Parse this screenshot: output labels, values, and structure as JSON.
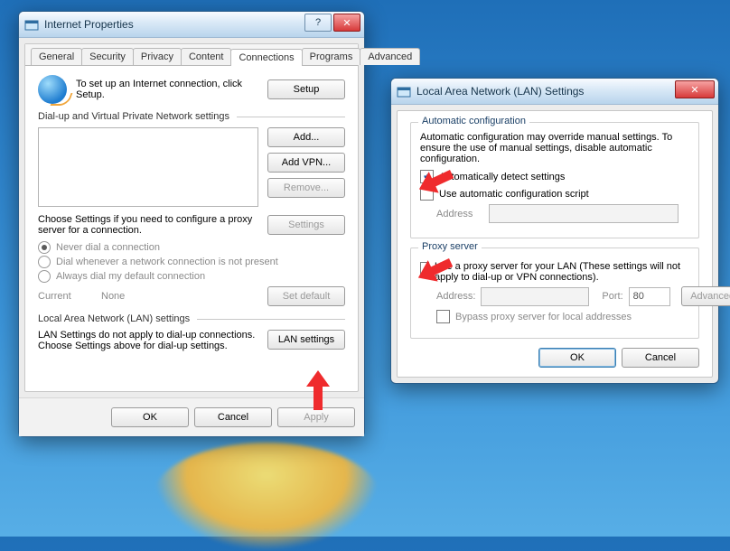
{
  "dialog1": {
    "title": "Internet Properties",
    "tabs": [
      "General",
      "Security",
      "Privacy",
      "Content",
      "Connections",
      "Programs",
      "Advanced"
    ],
    "activeTab": "Connections",
    "intro": "To set up an Internet connection, click Setup.",
    "setupBtn": "Setup",
    "group_dialup": "Dial-up and Virtual Private Network settings",
    "addBtn": "Add...",
    "addVpnBtn": "Add VPN...",
    "removeBtn": "Remove...",
    "chooseSettings": "Choose Settings if you need to configure a proxy server for a connection.",
    "settingsBtn": "Settings",
    "radios": {
      "never": "Never dial a connection",
      "whenever": "Dial whenever a network connection is not present",
      "always": "Always dial my default connection"
    },
    "currentLbl": "Current",
    "currentVal": "None",
    "setDefaultBtn": "Set default",
    "group_lan": "Local Area Network (LAN) settings",
    "lanNote1": "LAN Settings do not apply to dial-up connections.",
    "lanNote2": "Choose Settings above for dial-up settings.",
    "lanBtn": "LAN settings",
    "ok": "OK",
    "cancel": "Cancel",
    "apply": "Apply"
  },
  "dialog2": {
    "title": "Local Area Network (LAN) Settings",
    "group_auto": "Automatic configuration",
    "autoNote": "Automatic configuration may override manual settings. To ensure the use of manual settings, disable automatic configuration.",
    "chk_autoDetect": "Automatically detect settings",
    "chk_autoScript": "Use automatic configuration script",
    "addressLbl": "Address",
    "group_proxy": "Proxy server",
    "chk_proxy": "Use a proxy server for your LAN (These settings will not apply to dial-up or VPN connections).",
    "addressLbl2": "Address:",
    "portLbl": "Port:",
    "portVal": "80",
    "advancedBtn": "Advanced",
    "chk_bypass": "Bypass proxy server for local addresses",
    "ok": "OK",
    "cancel": "Cancel"
  }
}
